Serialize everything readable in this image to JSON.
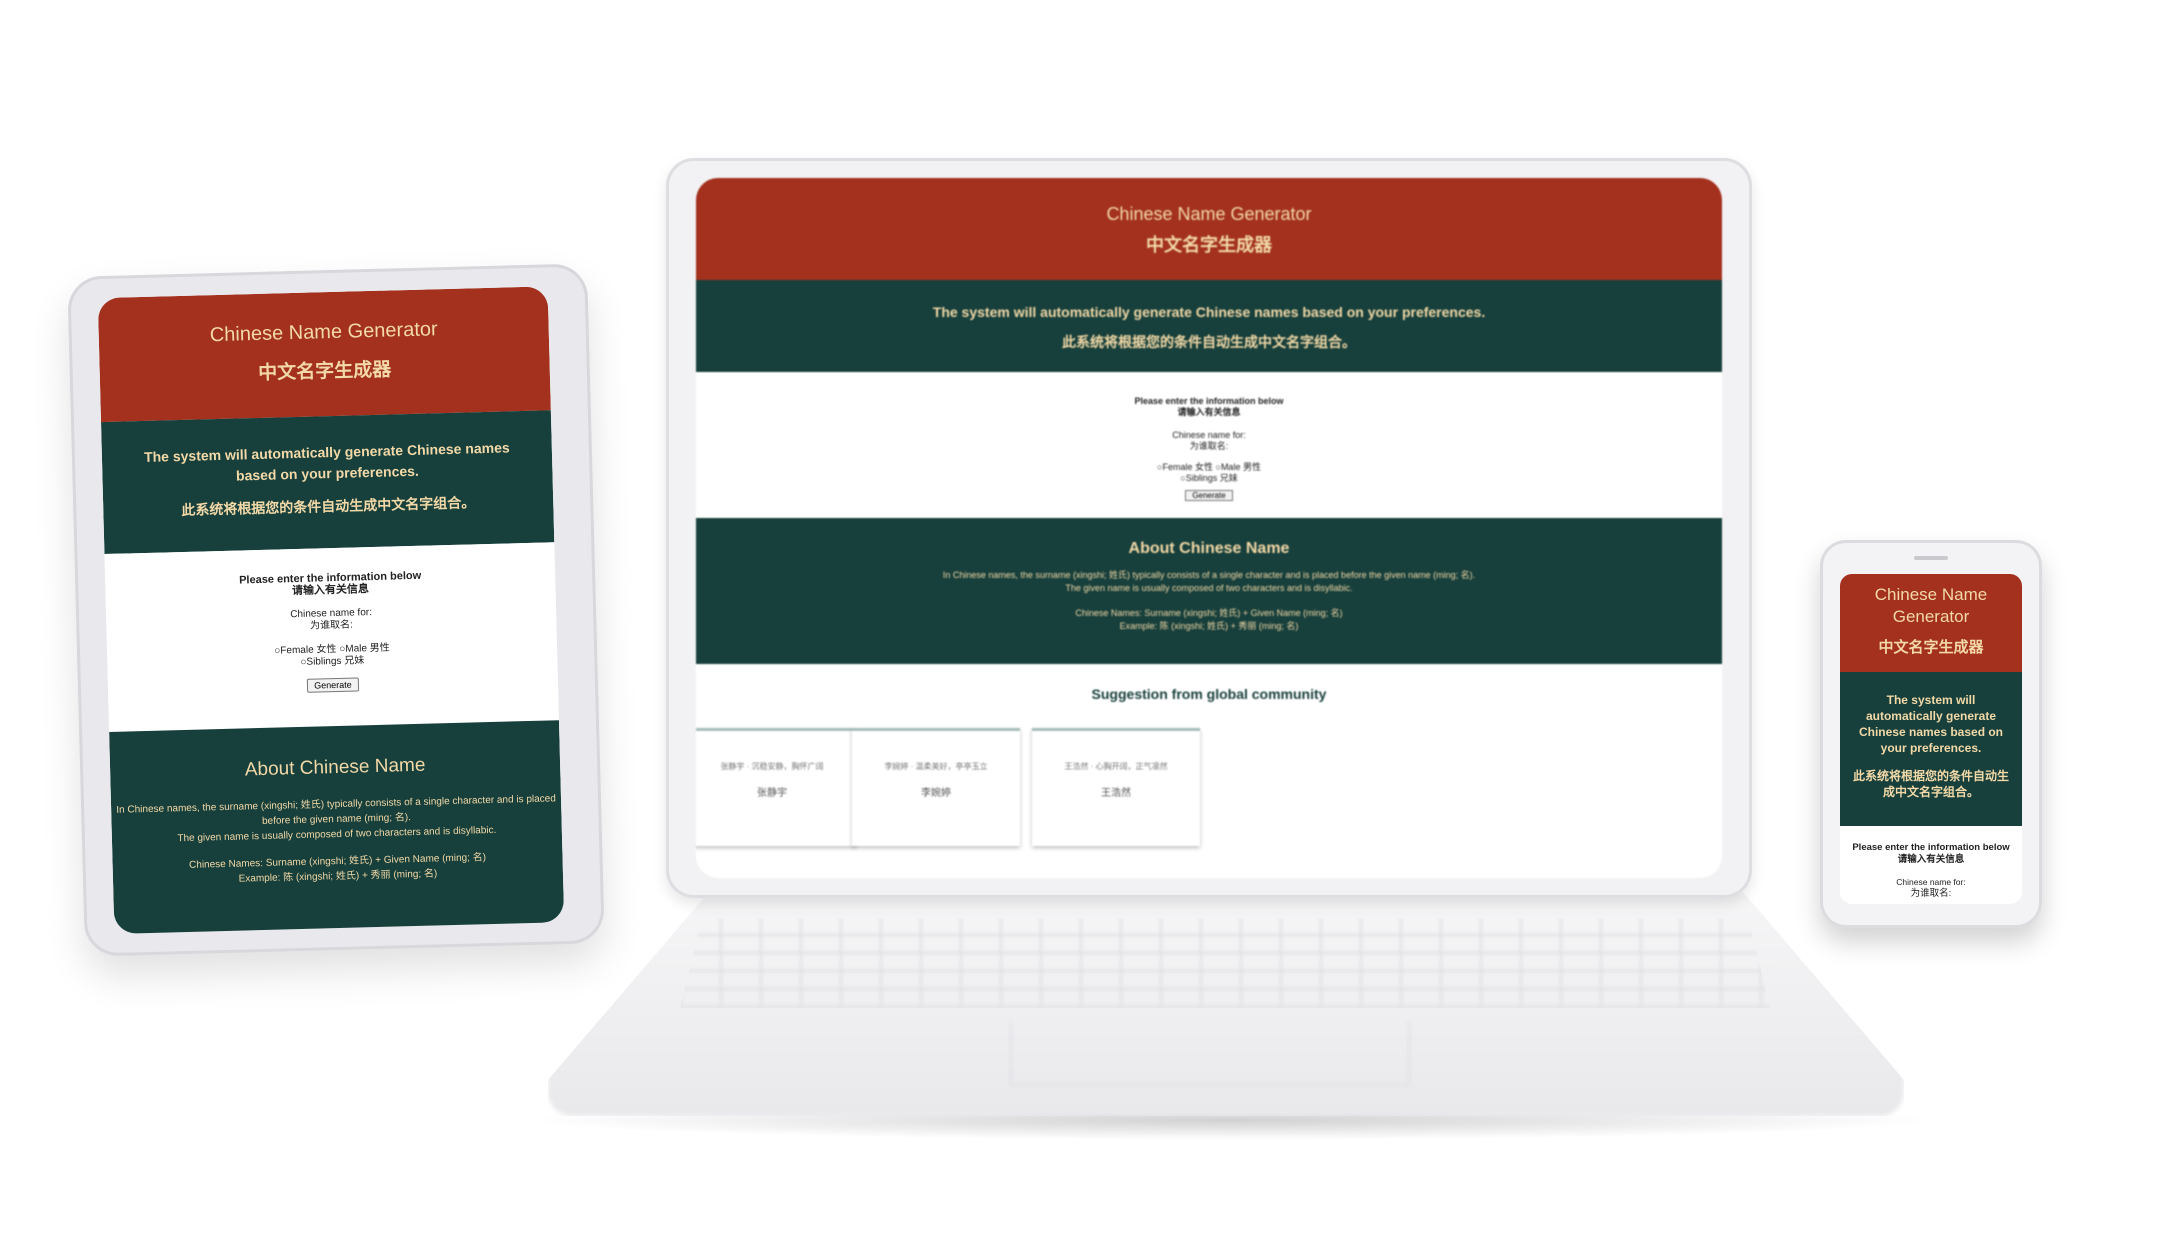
{
  "app": {
    "title": "Chinese Name Generator",
    "title_cn": "中文名字生成器"
  },
  "intro": {
    "en": "The system will automatically generate Chinese names based on your preferences.",
    "cn": "此系统将根据您的条件自动生成中文名字组合。"
  },
  "form": {
    "heading": "Please enter the information below",
    "heading_cn": "请输入有关信息",
    "name_for_label": "Chinese name for:",
    "name_for_label_cn": "为谁取名:",
    "options": [
      "Female 女性",
      "Male 男性",
      "Siblings 兄妹"
    ],
    "generate_button": "Generate"
  },
  "about": {
    "title": "About Chinese Name",
    "line1": "In Chinese names, the surname (xingshi; 姓氏) typically consists of a single character and is placed before the given name (ming; 名).",
    "line2": "The given name is usually composed of two characters and is disyllabic.",
    "formula": "Chinese Names: Surname (xingshi; 姓氏) + Given Name (ming; 名)",
    "example": "Example: 陈 (xingshi; 姓氏) + 秀丽 (ming; 名)"
  },
  "community": {
    "title": "Suggestion from global community",
    "cards": [
      {
        "desc": "张静宇 · 沉稳安静，胸怀广阔",
        "name": "张静宇"
      },
      {
        "desc": "李婉婷 · 温柔美好，亭亭玉立",
        "name": "李婉婷"
      },
      {
        "desc": "王浩然 · 心胸开阔，正气凛然",
        "name": "王浩然"
      }
    ]
  },
  "colors": {
    "header_red": "#a3311e",
    "section_green": "#173f3b",
    "accent_text": "#f2d9a7"
  }
}
